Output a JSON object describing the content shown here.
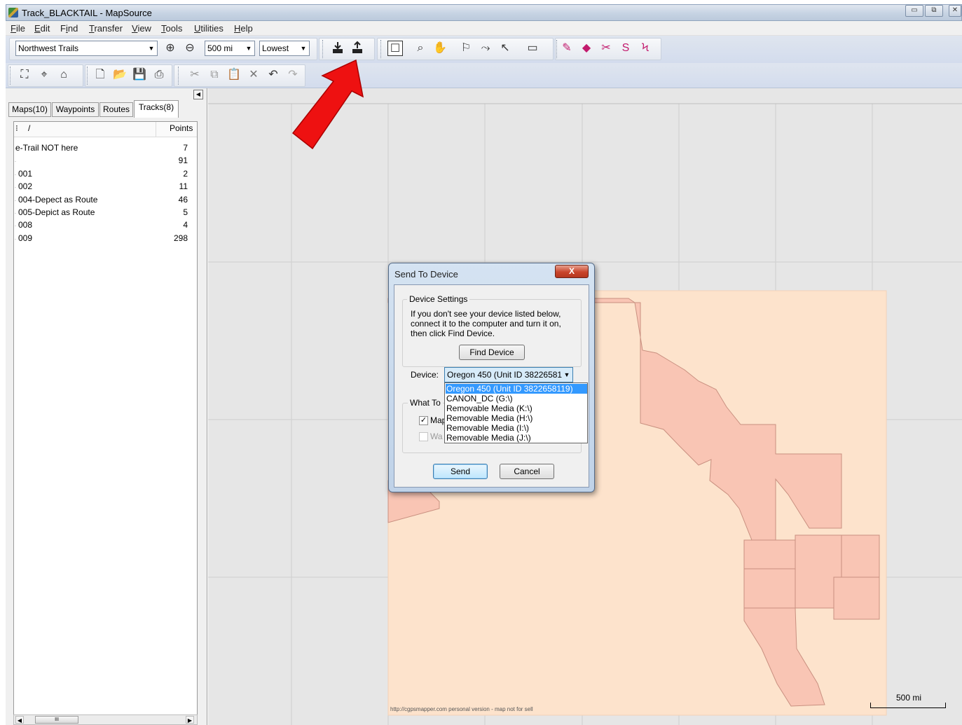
{
  "window": {
    "title": "Track_BLACKTAIL - MapSource",
    "minimize_label": "▭",
    "restore_label": "⧉",
    "close_label": "✕"
  },
  "menu": [
    "File",
    "Edit",
    "Find",
    "Transfer",
    "View",
    "Tools",
    "Utilities",
    "Help"
  ],
  "menu_underline": [
    "F",
    "E",
    "i",
    "T",
    "V",
    "T",
    "U",
    "H"
  ],
  "toolbar": {
    "product_select": "Northwest Trails",
    "zoom_select": "500 mi",
    "detail_select": "Lowest"
  },
  "tabs": [
    "Maps(10)",
    "Waypoints",
    "Routes",
    "Tracks(8)"
  ],
  "active_tab": "Tracks(8)",
  "list": {
    "col_name": "/",
    "col_points": "Points",
    "rows": [
      {
        "name": "e-Trail NOT here",
        "points": "7"
      },
      {
        "name": "",
        "points": "91"
      },
      {
        "name": "001",
        "points": "2"
      },
      {
        "name": "002",
        "points": "11"
      },
      {
        "name": "004-Depect as Route",
        "points": "46"
      },
      {
        "name": "005-Depict as Route",
        "points": "5"
      },
      {
        "name": "008",
        "points": "4"
      },
      {
        "name": "009",
        "points": "298"
      }
    ]
  },
  "map": {
    "credit": "http://cgpsmapper.com personal version - map not for sell",
    "scale_label": "500 mi",
    "land_color": "#fde3cc",
    "region_color": "#f9c5b4",
    "region_border": "#c99080"
  },
  "dialog": {
    "title": "Send To Device",
    "close_label": "X",
    "device_settings_label": "Device Settings",
    "help_text": "If you don't see your device listed below, connect it to the computer and turn it on, then click Find Device.",
    "find_button": "Find Device",
    "device_label": "Device:",
    "device_value": "Oregon 450 (Unit ID 38226581",
    "what_to_label": "What To",
    "maps_check_label": "Map",
    "waypoints_check_label": "Wa",
    "send_button": "Send",
    "cancel_button": "Cancel",
    "dropdown_options": [
      "Oregon 450 (Unit ID 3822658119)",
      "CANON_DC (G:\\)",
      "Removable Media (K:\\)",
      "Removable Media (H:\\)",
      "Removable Media (I:\\)",
      "Removable Media (J:\\)"
    ]
  },
  "annotation": {
    "arrow_color": "#ee1111"
  }
}
